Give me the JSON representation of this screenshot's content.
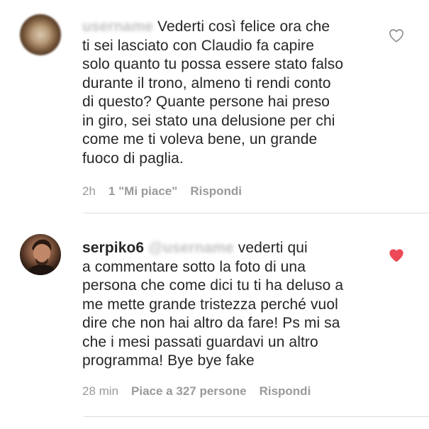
{
  "comments": [
    {
      "username_obscured": "username",
      "lines": [
        "Vederti così felice ora che",
        "ti sei lasciato con Claudio fa capire",
        "solo quanto tu possa essere stato falso",
        "durante il trono, almeno ti rendi conto",
        "di questo? Quante persone hai preso",
        "in giro, sei stato una delusione per chi",
        "come me ti voleva bene, un grande",
        "fuoco di paglia."
      ],
      "time": "2h",
      "likes": "1 \"Mi piace\"",
      "reply": "Rispondi",
      "liked": false,
      "heart_icon": "heart-outline-icon"
    },
    {
      "username": "serpiko6",
      "mention_obscured": "@username",
      "lines": [
        "vederti qui",
        "a commentare sotto la foto di una",
        "persona che come dici tu ti ha deluso a",
        "me mette grande tristezza perché vuol",
        "dire che non hai altro da fare! Ps mi sa",
        "che i mesi passati guardavi un altro",
        "programma! Bye bye fake"
      ],
      "time": "28 min",
      "likes": "Piace a 327 persone",
      "reply": "Rispondi",
      "liked": true,
      "heart_icon": "heart-filled-icon"
    }
  ],
  "colors": {
    "text": "#262626",
    "meta": "#9a9a9a",
    "heart_liked": "#ed4956",
    "heart_outline": "#8e8e8e",
    "divider": "#dbdbdb"
  }
}
